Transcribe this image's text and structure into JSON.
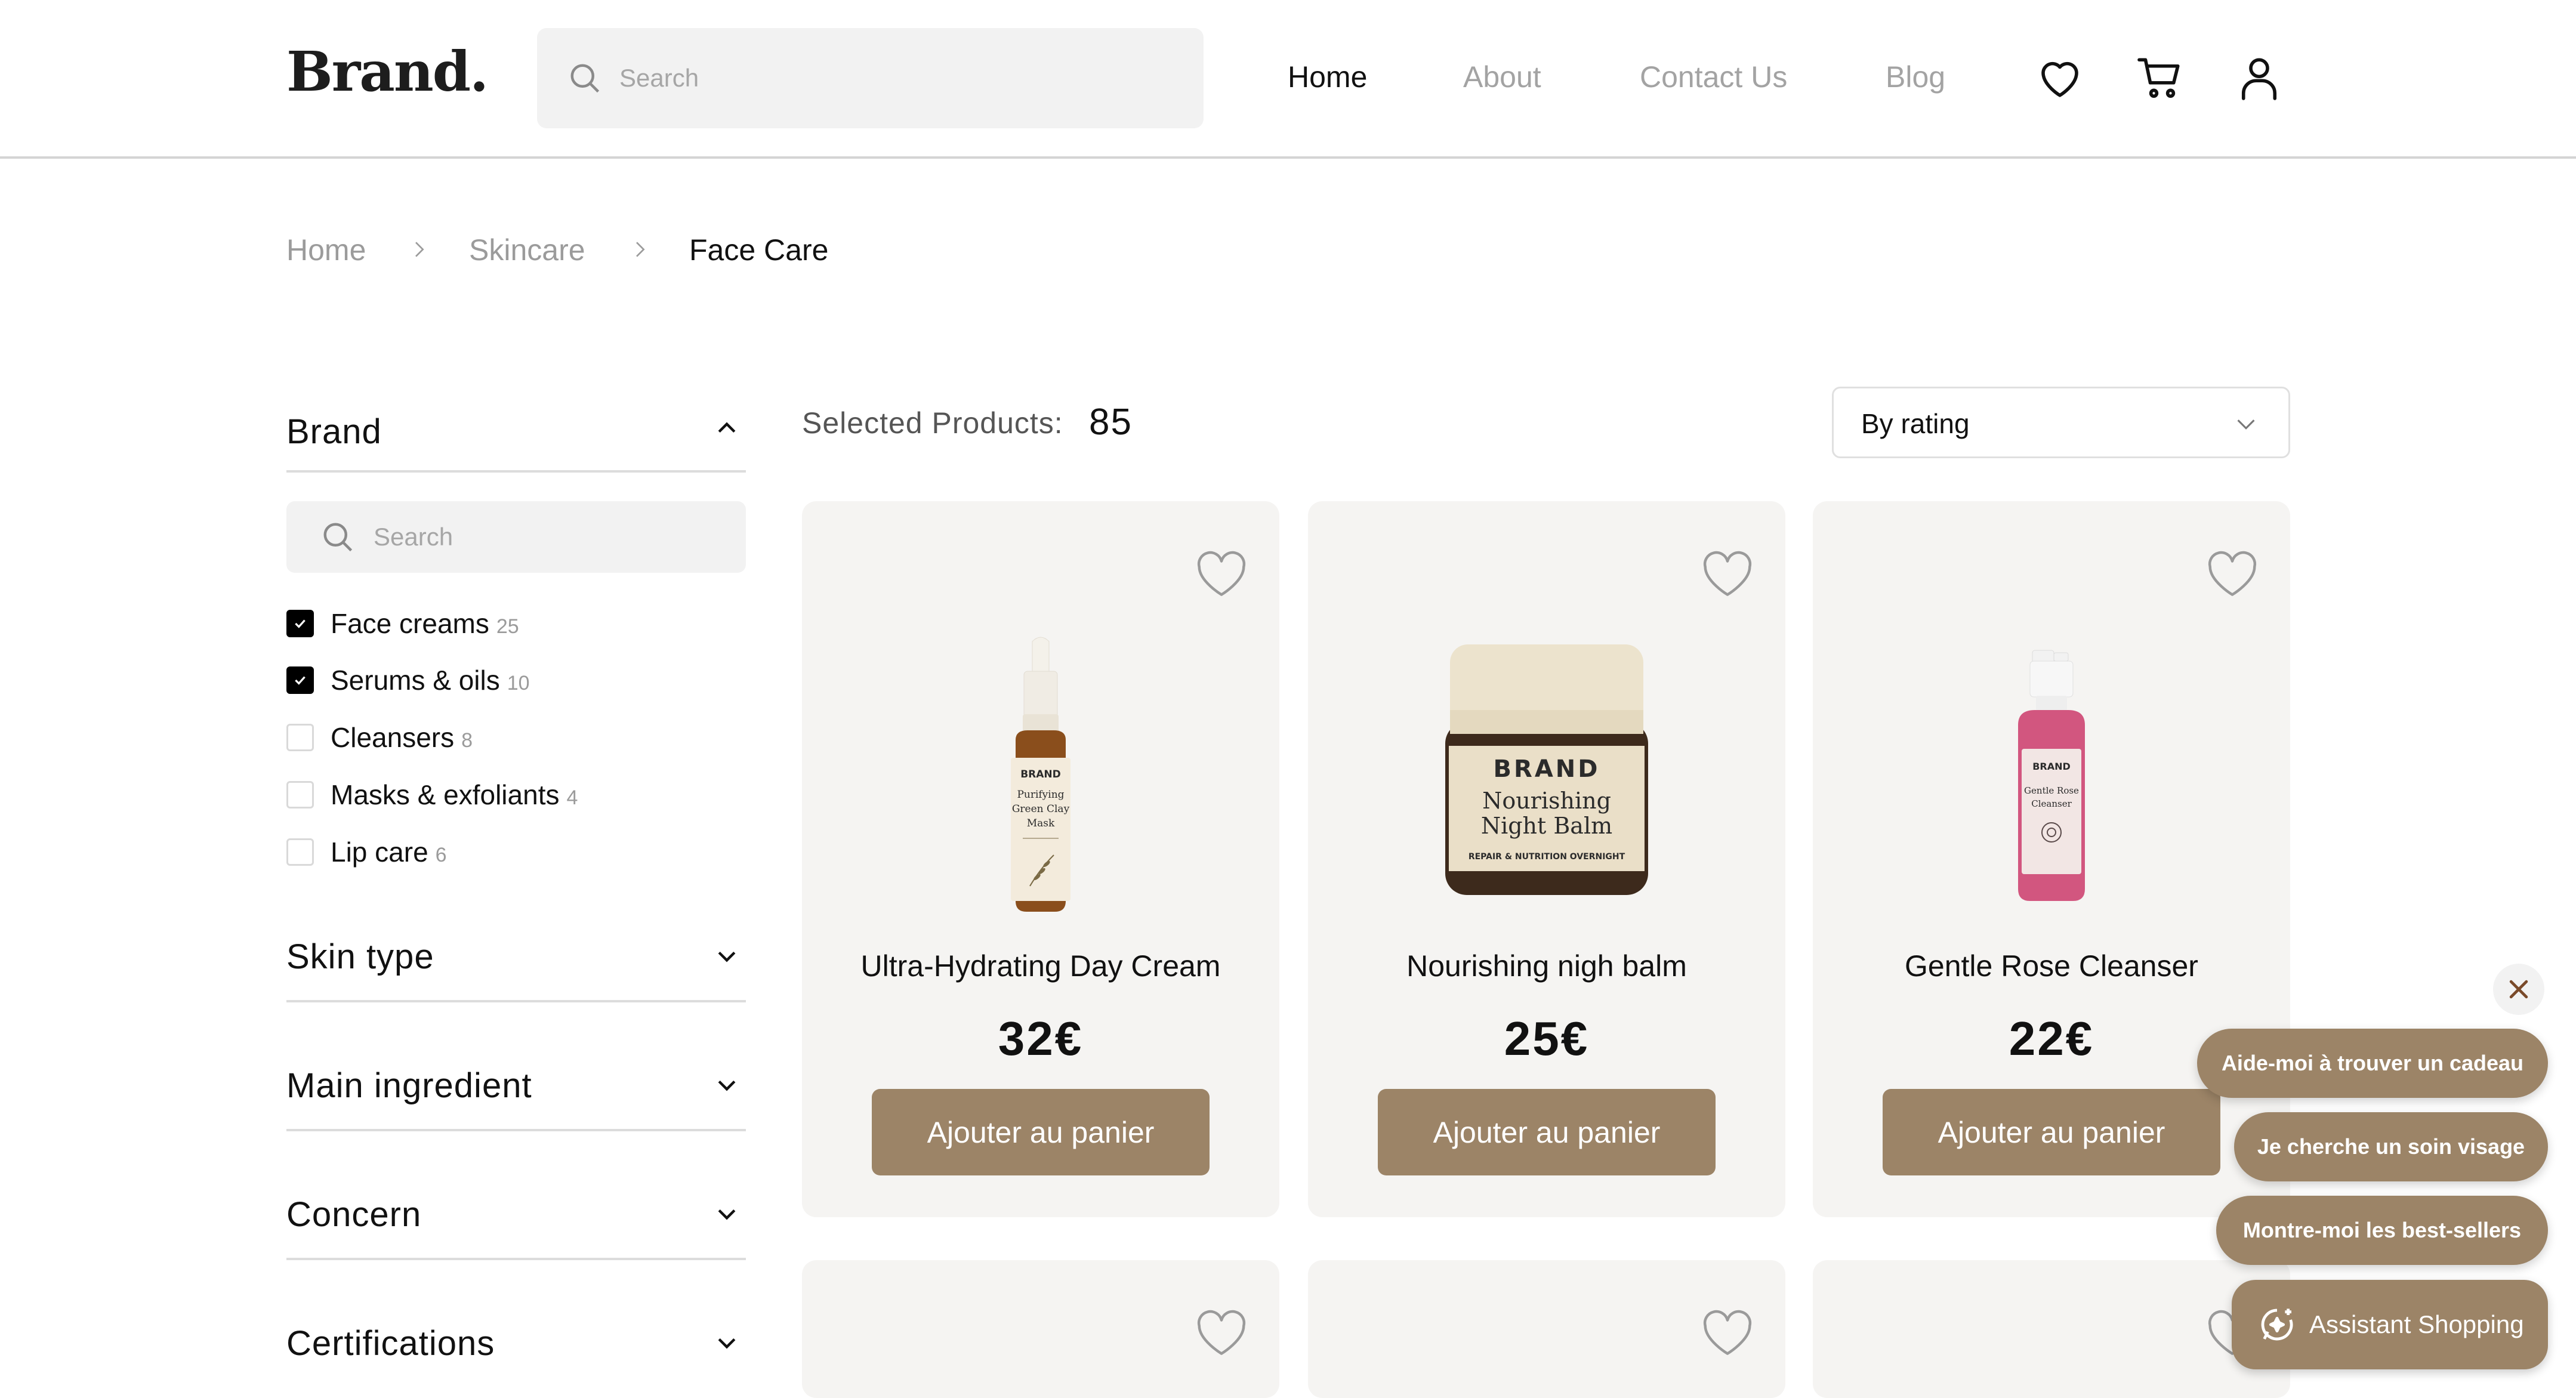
{
  "header": {
    "logo": "Brand.",
    "search_placeholder": "Search",
    "nav": [
      "Home",
      "About",
      "Contact Us",
      "Blog"
    ],
    "active_nav": "Home",
    "icons": [
      "heart-icon",
      "cart-icon",
      "user-icon"
    ]
  },
  "breadcrumb": [
    "Home",
    "Skincare",
    "Face Care"
  ],
  "filters": {
    "brand": {
      "title": "Brand",
      "search_placeholder": "Search",
      "options": [
        {
          "label": "Face creams",
          "count": "25",
          "checked": true
        },
        {
          "label": "Serums & oils",
          "count": "10",
          "checked": true
        },
        {
          "label": "Cleansers",
          "count": "8",
          "checked": false
        },
        {
          "label": "Masks & exfoliants",
          "count": "4",
          "checked": false
        },
        {
          "label": "Lip care",
          "count": "6",
          "checked": false
        }
      ]
    },
    "collapsed": [
      "Skin type",
      "Main ingredient",
      "Concern",
      "Certifications"
    ]
  },
  "toolbar": {
    "selected_label": "Selected Products:",
    "selected_count": "85",
    "sort_value": "By rating"
  },
  "products": [
    {
      "name": "Ultra-Hydrating Day Cream",
      "price": "32€",
      "button": "Ajouter au panier",
      "label": {
        "brand": "BRAND",
        "line1": "Purifying",
        "line2": "Green Clay",
        "line3": "Mask"
      }
    },
    {
      "name": "Nourishing nigh balm",
      "price": "25€",
      "button": "Ajouter au panier",
      "label": {
        "brand": "BRAND",
        "line1": "Nourishing",
        "line2": "Night Balm",
        "line3": "REPAIR & NUTRITION OVERNIGHT"
      }
    },
    {
      "name": "Gentle Rose Cleanser",
      "price": "22€",
      "button": "Ajouter au panier",
      "label": {
        "brand": "BRAND",
        "line1": "Gentle Rose",
        "line2": "Cleanser",
        "line3": ""
      }
    }
  ],
  "chat": {
    "suggestions": [
      "Aide-moi à trouver un cadeau",
      "Je cherche un soin visage",
      "Montre-moi les best-sellers"
    ],
    "assistant_label": "Assistant Shopping"
  },
  "colors": {
    "accent": "#9c8467",
    "card_bg": "#f5f4f2",
    "muted_text": "#a3a3a3"
  }
}
